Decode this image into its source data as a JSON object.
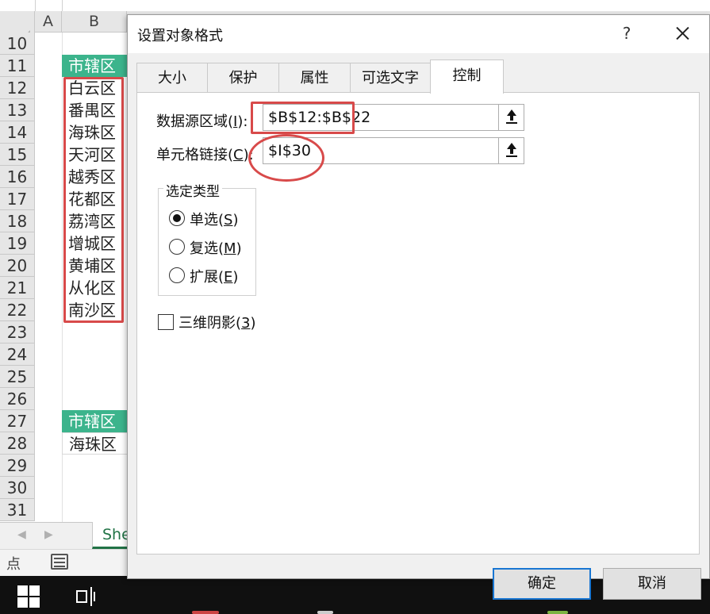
{
  "spreadsheet": {
    "columns": [
      "A",
      "B"
    ],
    "rows": [
      "10",
      "11",
      "12",
      "13",
      "14",
      "15",
      "16",
      "17",
      "18",
      "19",
      "20",
      "21",
      "22",
      "23",
      "24",
      "25",
      "26",
      "27",
      "28",
      "29",
      "30",
      "31"
    ],
    "list_header": "市辖区",
    "districts": [
      "白云区",
      "番禺区",
      "海珠区",
      "天河区",
      "越秀区",
      "花都区",
      "荔湾区",
      "增城区",
      "黄埔区",
      "从化区",
      "南沙区"
    ],
    "result_header": "市辖区",
    "result_value": "海珠区",
    "sheet_tab": "She",
    "status_text": "点",
    "accent_color": "#3cb48c"
  },
  "dialog": {
    "title": "设置对象格式",
    "help": "?",
    "tabs": [
      "大小",
      "保护",
      "属性",
      "可选文字",
      "控制"
    ],
    "active_tab": "控制",
    "data_source": {
      "label": "数据源区域(",
      "hotkey": "I",
      "label_end": "):",
      "value": "$B$12:$B$22"
    },
    "cell_link": {
      "label": "单元格链接(",
      "hotkey": "C",
      "label_end": "):",
      "value": "$I$30"
    },
    "selection_type": {
      "title": "选定类型",
      "options": [
        {
          "label": "单选(",
          "hotkey": "S",
          "end": ")",
          "checked": true
        },
        {
          "label": "复选(",
          "hotkey": "M",
          "end": ")",
          "checked": false
        },
        {
          "label": "扩展(",
          "hotkey": "E",
          "end": ")",
          "checked": false
        }
      ]
    },
    "shading_3d": {
      "label": "三维阴影(",
      "hotkey": "3",
      "end": ")",
      "checked": false
    },
    "ok_label": "确定",
    "cancel_label": "取消",
    "highlight_color": "#d84a4a"
  }
}
